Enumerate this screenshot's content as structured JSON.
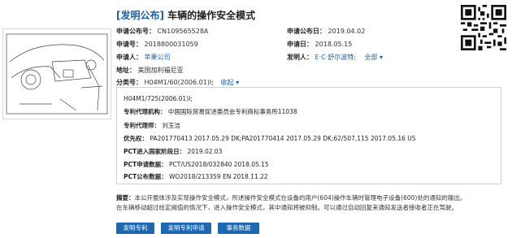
{
  "title": {
    "tag": "[发明公布]",
    "name": "车辆的操作安全模式"
  },
  "fields": {
    "pub_no": {
      "label": "申请公布号：",
      "value": "CN109565528A"
    },
    "pub_date": {
      "label": "申请公布日：",
      "value": "2019.04.02"
    },
    "app_no": {
      "label": "申请号：",
      "value": "2018800031059"
    },
    "app_date": {
      "label": "申请日：",
      "value": "2018.05.15"
    },
    "applicant": {
      "label": "申请人：",
      "value": "苹果公司"
    },
    "inventor": {
      "label": "发明人：",
      "value": "E·C·舒尔波特;",
      "more": "全部 ▾"
    },
    "address": {
      "label": "地址：",
      "value": "美国加利福尼亚"
    },
    "ipc": {
      "label": "分类号：",
      "value": "H04M1/60(2006.01)I;",
      "toggle": "收起 ▾"
    }
  },
  "detail": {
    "ipc_extra": "H04M1/725(2006.01)I;",
    "agency": {
      "label": "专利代理机构：",
      "value": "中国国际贸易促进委员会专利商标事务所11038"
    },
    "agent": {
      "label": "专利代理师：",
      "value": "刘玉洁"
    },
    "priority": {
      "label": "优先权：",
      "value": "PA201770413 2017.05.29 DK;PA201770414 2017.05.29 DK;62/507,115 2017.05.16 US"
    },
    "pct_entry": {
      "label": "PCT进入国家阶段日：",
      "value": "2019.02.03"
    },
    "pct_app": {
      "label": "PCT申请数据：",
      "value": "PCT/US2018/032840 2018.05.15"
    },
    "pct_pub": {
      "label": "PCT公布数据：",
      "value": "WO2018/213359 EN 2018.11.22"
    }
  },
  "abstract": {
    "label": "摘要：",
    "line1": "本公开整体涉及实现操作安全模式，所述操作安全模式在设备的用户(604)操作车辆时管理电子设备(600)处的通知的输出。",
    "line2": "在车辆移动超过给定阈值的情况下，进入操作安全模式，其中通知将被抑制。可以通过自动回复来通知发送者接收者正在驾驶。"
  },
  "buttons": {
    "patent": "发明专利",
    "application": "发明专利申请",
    "affairs": "事务数据"
  },
  "colors": {
    "accent": "#1d67b3",
    "link": "#1a5fa8"
  },
  "icons": {
    "figure": "patent-drawing-thumbnail",
    "qr": "qr-code-icon"
  }
}
